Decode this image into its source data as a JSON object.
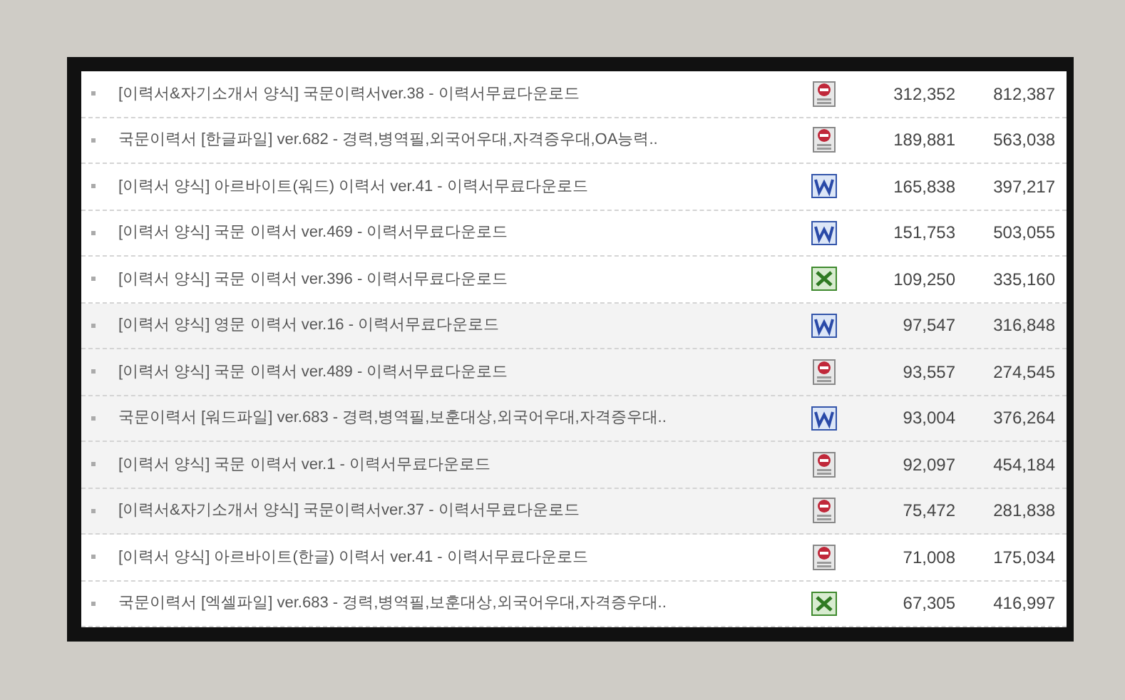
{
  "rows": [
    {
      "title": "[이력서&자기소개서 양식] 국문이력서ver.38 - 이력서무료다운로드",
      "kind": "hwp",
      "views": "312,352",
      "downloads": "812,387",
      "highlighted": false
    },
    {
      "title": "국문이력서 [한글파일] ver.682 - 경력,병역필,외국어우대,자격증우대,OA능력..",
      "kind": "hwp",
      "views": "189,881",
      "downloads": "563,038",
      "highlighted": false
    },
    {
      "title": "[이력서 양식] 아르바이트(워드) 이력서 ver.41 - 이력서무료다운로드",
      "kind": "word",
      "views": "165,838",
      "downloads": "397,217",
      "highlighted": false
    },
    {
      "title": "[이력서 양식] 국문 이력서 ver.469 - 이력서무료다운로드",
      "kind": "word",
      "views": "151,753",
      "downloads": "503,055",
      "highlighted": false
    },
    {
      "title": "[이력서 양식] 국문 이력서 ver.396 - 이력서무료다운로드",
      "kind": "excel",
      "views": "109,250",
      "downloads": "335,160",
      "highlighted": false
    },
    {
      "title": "[이력서 양식] 영문 이력서 ver.16 - 이력서무료다운로드",
      "kind": "word",
      "views": "97,547",
      "downloads": "316,848",
      "highlighted": true
    },
    {
      "title": "[이력서 양식] 국문 이력서 ver.489 - 이력서무료다운로드",
      "kind": "hwp",
      "views": "93,557",
      "downloads": "274,545",
      "highlighted": true
    },
    {
      "title": "국문이력서 [워드파일] ver.683 - 경력,병역필,보훈대상,외국어우대,자격증우대..",
      "kind": "word",
      "views": "93,004",
      "downloads": "376,264",
      "highlighted": true
    },
    {
      "title": "[이력서 양식] 국문 이력서 ver.1 - 이력서무료다운로드",
      "kind": "hwp",
      "views": "92,097",
      "downloads": "454,184",
      "highlighted": true
    },
    {
      "title": "[이력서&자기소개서 양식] 국문이력서ver.37 - 이력서무료다운로드",
      "kind": "hwp",
      "views": "75,472",
      "downloads": "281,838",
      "highlighted": true
    },
    {
      "title": "[이력서 양식] 아르바이트(한글) 이력서 ver.41 - 이력서무료다운로드",
      "kind": "hwp",
      "views": "71,008",
      "downloads": "175,034",
      "highlighted": false
    },
    {
      "title": "국문이력서 [엑셀파일] ver.683 - 경력,병역필,보훈대상,외국어우대,자격증우대..",
      "kind": "excel",
      "views": "67,305",
      "downloads": "416,997",
      "highlighted": false
    }
  ]
}
